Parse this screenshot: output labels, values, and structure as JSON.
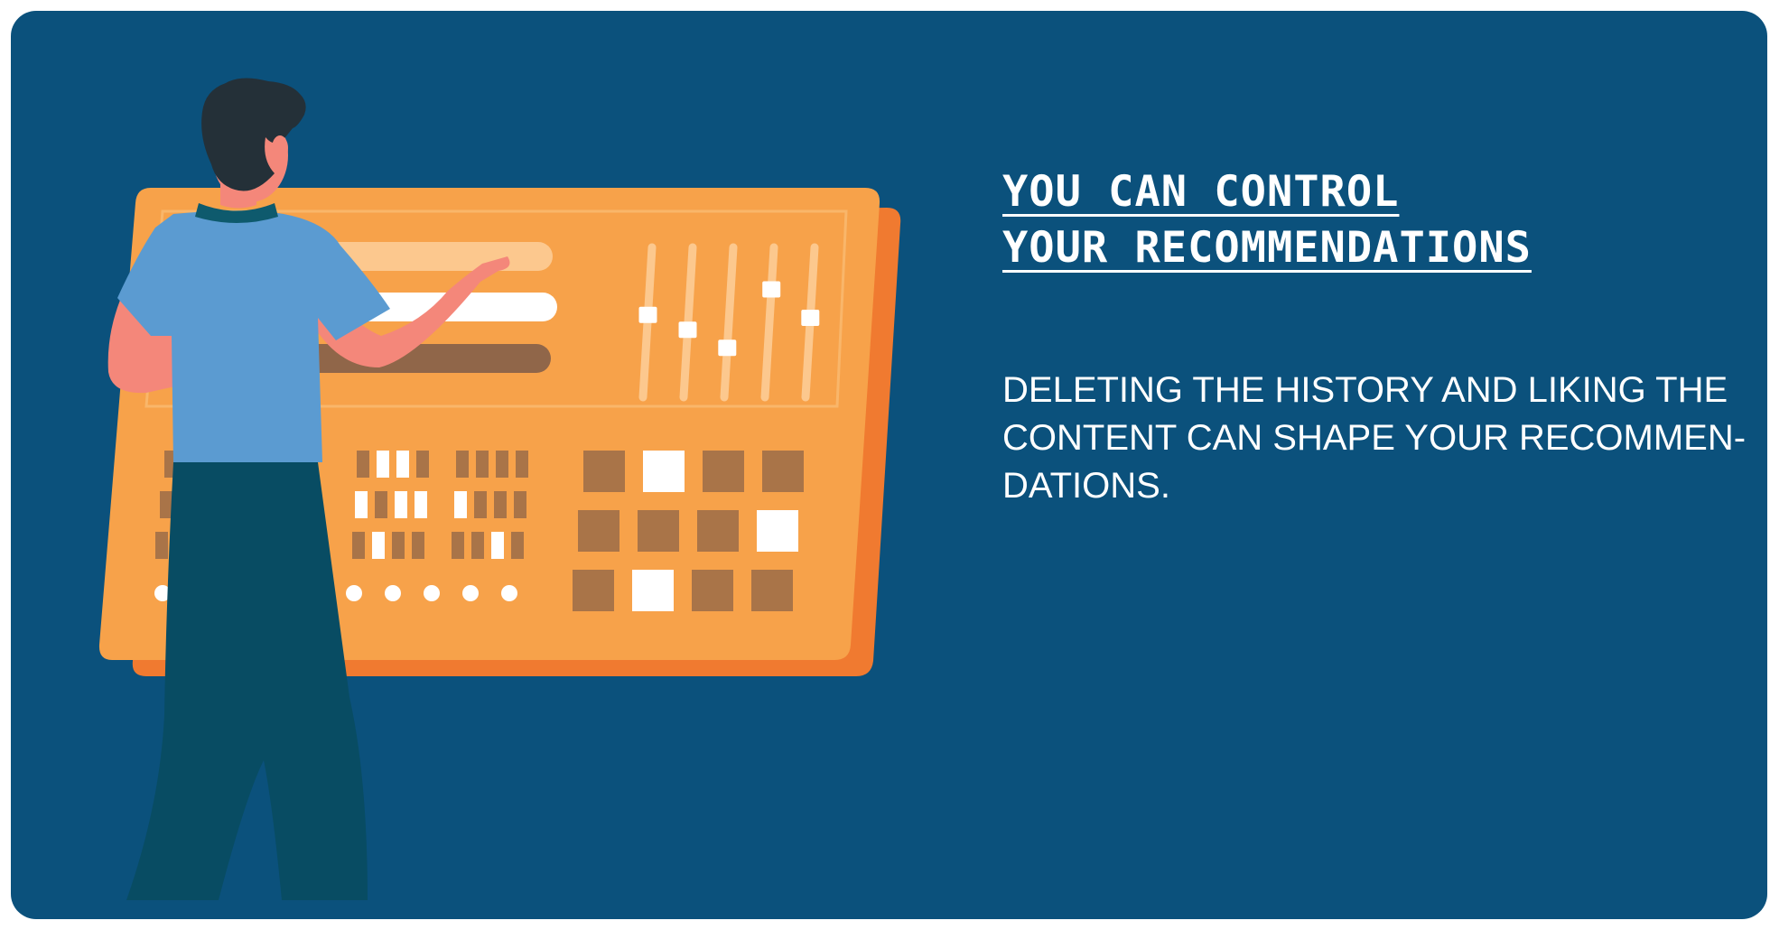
{
  "headline": {
    "line1": "YOU CAN CONTROL",
    "line2": "YOUR RECOMMENDATIONS"
  },
  "body": {
    "line1": "DELETING THE HISTORY AND LIKING THE",
    "line2": "CONTENT CAN SHAPE YOUR RECOMMEN-",
    "line3": "DATIONS."
  },
  "colors": {
    "background": "#0b517c",
    "panel": "#f7a24a",
    "panel_shadow": "#f07a30",
    "shirt": "#5b9bd1",
    "pants": "#084c63",
    "hair": "#243038",
    "skin": "#f4877a",
    "accent_brown": "#a97448"
  },
  "illustration": {
    "subject": "person-adjusting-control-panel",
    "slider_levels": [
      0.55,
      0.45,
      0.33,
      0.72,
      0.53
    ]
  }
}
